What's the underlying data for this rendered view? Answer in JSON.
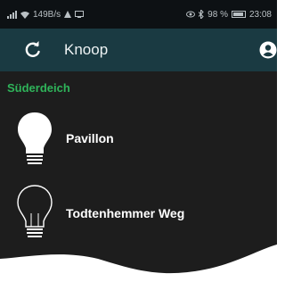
{
  "status_bar": {
    "data_rate": "149B/s",
    "battery_percent": "98 %",
    "time": "23:08",
    "icons": [
      "signal-icon",
      "wifi-icon",
      "upload-icon",
      "notification-icon",
      "eye-icon",
      "bluetooth-icon",
      "battery-icon"
    ]
  },
  "toolbar": {
    "title": "Knoop",
    "refresh_icon": "refresh-icon",
    "account_icon": "account-icon"
  },
  "section": {
    "header": "Süderdeich"
  },
  "lights": [
    {
      "name": "Pavillon",
      "state": "on"
    },
    {
      "name": "Todtenhemmer Weg",
      "state": "off"
    }
  ],
  "colors": {
    "status_bar_bg": "#0d1114",
    "toolbar_bg": "#1a3a42",
    "list_bg": "#1d1d1d",
    "section_header": "#2fb45a",
    "text": "#ffffff"
  }
}
